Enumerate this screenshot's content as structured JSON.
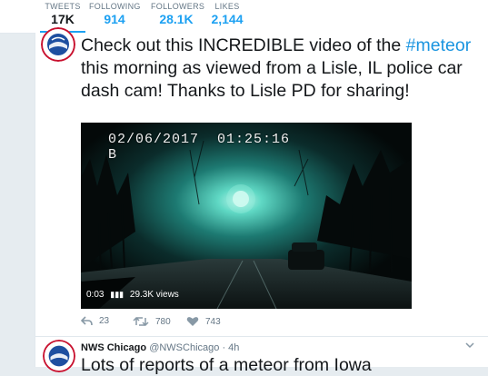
{
  "stats": [
    {
      "label": "TWEETS",
      "value": "17K"
    },
    {
      "label": "FOLLOWING",
      "value": "914"
    },
    {
      "label": "FOLLOWERS",
      "value": "28.1K"
    },
    {
      "label": "LIKES",
      "value": "2,144"
    }
  ],
  "tweet1": {
    "text_before": "Check out this INCREDIBLE video of the ",
    "hashtag": "#meteor",
    "text_after": " this morning as viewed from a Lisle, IL police car dash cam! Thanks to Lisle PD for sharing!",
    "video": {
      "timestamp_date": "02/06/2017",
      "timestamp_time": "01:25:16",
      "camera_label": "B",
      "duration": "0:03",
      "views": "29.3K views"
    },
    "actions": {
      "replies": "23",
      "retweets": "780",
      "likes": "743"
    }
  },
  "tweet2": {
    "name": "NWS Chicago",
    "handle": "@NWSChicago",
    "time": "· 4h",
    "text": "Lots of reports of a meteor from Iowa"
  },
  "colors": {
    "accent": "#1da1f2",
    "hashtag": "#1b95e0",
    "text": "#14171a",
    "muted": "#657786",
    "background": "#e6ecf0"
  },
  "icons": [
    "nws-logo-icon",
    "play-bars-icon",
    "reply-icon",
    "retweet-icon",
    "like-icon",
    "chevron-down-icon"
  ]
}
